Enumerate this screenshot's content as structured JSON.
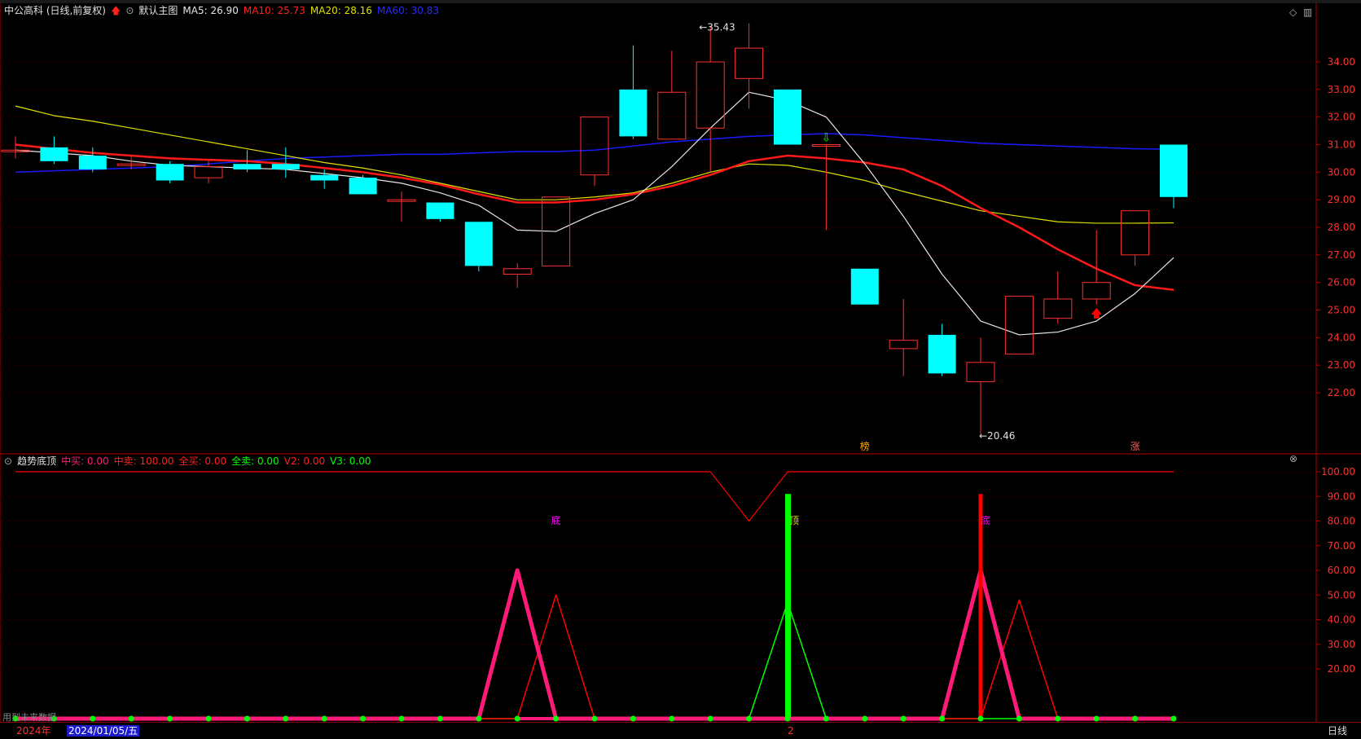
{
  "colors": {
    "bg": "#000000",
    "grid": "#3a0000",
    "axis": "#b00000",
    "up": "#ff3030",
    "down": "#00ffff",
    "ma5": "#e6e6e6",
    "ma10": "#ff1a1a",
    "ma20": "#e0e000",
    "ma60": "#1a1aff",
    "pink": "#ff1a7a",
    "green": "#00ff00",
    "red": "#ff0000",
    "magenta": "#ff00ff"
  },
  "header": {
    "title": "中公高科 (日线,前复权)",
    "main_label": "默认主图",
    "ma5": "MA5: 26.90",
    "ma10": "MA10: 25.73",
    "ma20": "MA20: 28.16",
    "ma60": "MA60: 30.83"
  },
  "indicator_header": {
    "name": "趋势底顶",
    "zhongmai": "中买: 0.00",
    "zhongmai2": "中卖: 100.00",
    "quanmai": "全买: 0.00",
    "quanmai2": "全卖: 0.00",
    "v2": "V2: 0.00",
    "v3": "V3: 0.00"
  },
  "controls": {
    "diamond": "◇",
    "bars": "▥",
    "close": "⊗"
  },
  "bottom": {
    "year": "2024年",
    "date": "2024/01/05/五",
    "marker": "2",
    "period": "日线",
    "hint": "用到未来数据"
  },
  "annotations": {
    "high": "←35.43",
    "low": "←20.46",
    "bang": "榜",
    "zhang": "涨",
    "di1": "底",
    "ding": "顶",
    "di2": "底"
  },
  "chart_data": [
    {
      "type": "candlestick",
      "yticks": [
        "34.00",
        "33.00",
        "32.00",
        "31.00",
        "30.00",
        "29.00",
        "28.00",
        "27.00",
        "26.00",
        "25.00",
        "24.00",
        "23.00",
        "22.00"
      ],
      "ylim": [
        20,
        35.9
      ],
      "candles": [
        {
          "o": 30.8,
          "c": 30.8,
          "h": 31.3,
          "l": 30.5
        },
        {
          "o": 30.9,
          "c": 30.4,
          "h": 31.3,
          "l": 30.3
        },
        {
          "o": 30.6,
          "c": 30.1,
          "h": 30.9,
          "l": 30.0
        },
        {
          "o": 30.3,
          "c": 30.3,
          "h": 30.6,
          "l": 30.1
        },
        {
          "o": 30.3,
          "c": 29.7,
          "h": 30.4,
          "l": 29.6
        },
        {
          "o": 29.8,
          "c": 30.2,
          "h": 30.4,
          "l": 29.6
        },
        {
          "o": 30.3,
          "c": 30.1,
          "h": 30.8,
          "l": 30.0
        },
        {
          "o": 30.3,
          "c": 30.1,
          "h": 30.9,
          "l": 29.8
        },
        {
          "o": 29.9,
          "c": 29.7,
          "h": 30.1,
          "l": 29.4
        },
        {
          "o": 29.8,
          "c": 29.2,
          "h": 29.9,
          "l": 29.2
        },
        {
          "o": 29.0,
          "c": 29.0,
          "h": 29.3,
          "l": 28.2
        },
        {
          "o": 28.9,
          "c": 28.3,
          "h": 28.9,
          "l": 28.2
        },
        {
          "o": 28.2,
          "c": 26.6,
          "h": 28.2,
          "l": 26.4
        },
        {
          "o": 26.3,
          "c": 26.5,
          "h": 26.7,
          "l": 25.8
        },
        {
          "o": 26.6,
          "c": 29.1,
          "h": 29.1,
          "l": 26.6
        },
        {
          "o": 29.9,
          "c": 32.0,
          "h": 32.0,
          "l": 29.5
        },
        {
          "o": 33.0,
          "c": 31.3,
          "h": 34.6,
          "l": 31.2
        },
        {
          "o": 31.2,
          "c": 32.9,
          "h": 34.4,
          "l": 31.2
        },
        {
          "o": 31.6,
          "c": 34.0,
          "h": 35.3,
          "l": 30.0
        },
        {
          "o": 33.4,
          "c": 34.5,
          "h": 35.4,
          "l": 32.3
        },
        {
          "o": 33.0,
          "c": 31.0,
          "h": 33.0,
          "l": 31.0
        },
        {
          "o": 31.0,
          "c": 31.0,
          "h": 31.0,
          "l": 27.9
        },
        {
          "o": 26.5,
          "c": 25.2,
          "h": 26.5,
          "l": 25.2
        },
        {
          "o": 23.6,
          "c": 23.9,
          "h": 25.4,
          "l": 22.6
        },
        {
          "o": 24.1,
          "c": 22.7,
          "h": 24.5,
          "l": 22.6
        },
        {
          "o": 22.4,
          "c": 23.1,
          "h": 24.0,
          "l": 20.5
        },
        {
          "o": 23.4,
          "c": 25.5,
          "h": 25.5,
          "l": 23.4
        },
        {
          "o": 24.7,
          "c": 25.4,
          "h": 26.4,
          "l": 24.5
        },
        {
          "o": 25.4,
          "c": 26.0,
          "h": 27.9,
          "l": 25.2
        },
        {
          "o": 27.0,
          "c": 28.6,
          "h": 28.6,
          "l": 26.6
        },
        {
          "o": 31.0,
          "c": 29.1,
          "h": 31.0,
          "l": 28.7
        }
      ],
      "ma5": [
        30.8,
        30.7,
        30.6,
        30.4,
        30.25,
        30.2,
        30.15,
        30.1,
        29.95,
        29.8,
        29.6,
        29.25,
        28.8,
        27.9,
        27.85,
        28.5,
        29.0,
        30.2,
        31.6,
        32.9,
        32.6,
        32.0,
        30.3,
        28.4,
        26.3,
        24.6,
        24.1,
        24.2,
        24.6,
        25.6,
        26.9
      ],
      "ma10": [
        31.0,
        30.85,
        30.7,
        30.6,
        30.5,
        30.45,
        30.4,
        30.3,
        30.15,
        30.0,
        29.8,
        29.55,
        29.2,
        28.9,
        28.9,
        29.0,
        29.2,
        29.5,
        29.9,
        30.4,
        30.6,
        30.5,
        30.35,
        30.1,
        29.5,
        28.7,
        28.0,
        27.2,
        26.5,
        25.9,
        25.73
      ],
      "ma20": [
        32.4,
        32.05,
        31.85,
        31.6,
        31.35,
        31.1,
        30.85,
        30.6,
        30.35,
        30.15,
        29.9,
        29.6,
        29.3,
        29.0,
        29.0,
        29.1,
        29.25,
        29.6,
        30.0,
        30.3,
        30.25,
        30.0,
        29.7,
        29.3,
        28.95,
        28.6,
        28.4,
        28.2,
        28.15,
        28.15,
        28.16
      ],
      "ma60": [
        30.0,
        30.05,
        30.1,
        30.15,
        30.2,
        30.3,
        30.4,
        30.5,
        30.55,
        30.6,
        30.65,
        30.65,
        30.7,
        30.75,
        30.75,
        30.8,
        30.95,
        31.1,
        31.2,
        31.3,
        31.35,
        31.4,
        31.35,
        31.25,
        31.15,
        31.05,
        31.0,
        30.95,
        30.9,
        30.85,
        30.83
      ],
      "markers": [
        {
          "i": 21,
          "type": "down-arrow"
        },
        {
          "i": 28,
          "type": "up-arrow"
        }
      ]
    },
    {
      "type": "indicator",
      "yticks": [
        "100.00",
        "90.00",
        "80.00",
        "70.00",
        "60.00",
        "50.00",
        "40.00",
        "30.00",
        "20.00"
      ],
      "ylim": [
        0,
        100
      ],
      "top_line": [
        100,
        100,
        100,
        100,
        100,
        100,
        100,
        100,
        100,
        100,
        100,
        100,
        100,
        100,
        100,
        100,
        100,
        100,
        100,
        80,
        100,
        100,
        100,
        100,
        100,
        100,
        100,
        100,
        100,
        100,
        100
      ],
      "pink": [
        0,
        0,
        0,
        0,
        0,
        0,
        0,
        0,
        0,
        0,
        0,
        0,
        0,
        60,
        0,
        0,
        0,
        0,
        0,
        0,
        0,
        0,
        0,
        0,
        0,
        60,
        0,
        0,
        0,
        0,
        0
      ],
      "red_line": [
        0,
        0,
        0,
        0,
        0,
        0,
        0,
        0,
        0,
        0,
        0,
        0,
        0,
        0,
        50,
        0,
        0,
        0,
        0,
        0,
        0,
        0,
        0,
        0,
        0,
        0,
        48,
        0,
        0,
        0,
        0
      ],
      "green_line": [
        0,
        0,
        0,
        0,
        0,
        0,
        0,
        0,
        0,
        0,
        0,
        0,
        0,
        0,
        0,
        0,
        0,
        0,
        0,
        0,
        47,
        0,
        0,
        0,
        0,
        0,
        0,
        0,
        0,
        0,
        0
      ],
      "green_bar": {
        "i": 20,
        "v": 91
      },
      "red_bar": {
        "i": 25,
        "v": 91
      }
    }
  ]
}
